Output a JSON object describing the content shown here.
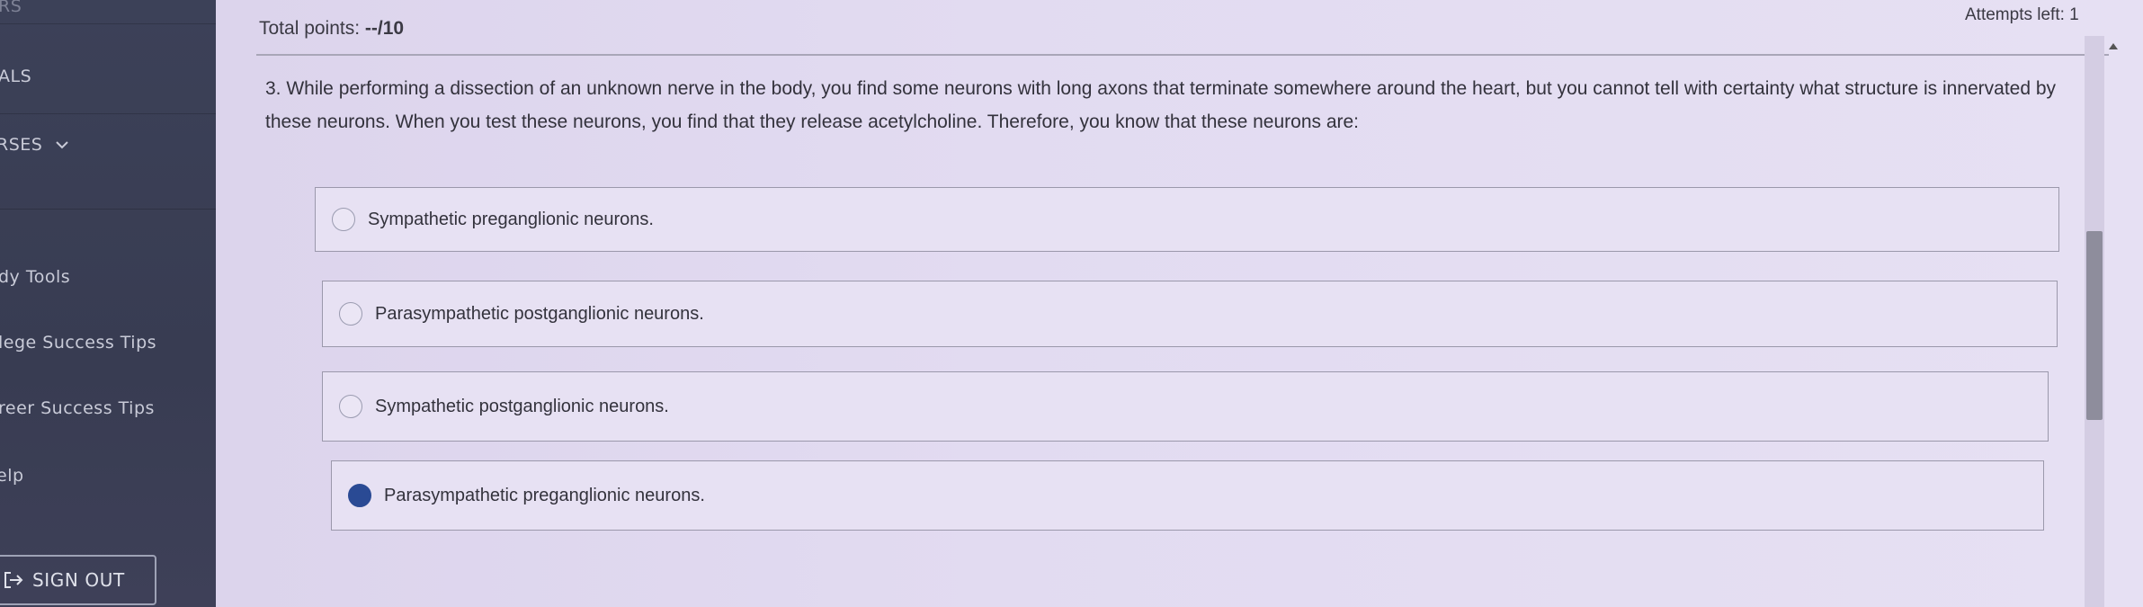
{
  "sidebar": {
    "items": [
      {
        "label": "RS"
      },
      {
        "label": "ALS"
      },
      {
        "label": "RSES"
      },
      {
        "label": "dy Tools"
      },
      {
        "label": "lege Success Tips"
      },
      {
        "label": "reer Success Tips"
      },
      {
        "label": "elp"
      }
    ],
    "sign_out_label": "SIGN OUT"
  },
  "header": {
    "total_points_label": "Total points: ",
    "total_points_value": "--/10",
    "attempts_left": "Attempts left: 1"
  },
  "question": {
    "text": "3. While performing a dissection of an unknown nerve in the body, you find some neurons with long axons that terminate somewhere around the heart, but you cannot tell with certainty what structure is innervated by these neurons. When you test these neurons, you find that they release acetylcholine. Therefore, you know that these neurons are:",
    "options": [
      {
        "label": "Sympathetic preganglionic neurons.",
        "selected": false
      },
      {
        "label": "Parasympathetic postganglionic neurons.",
        "selected": false
      },
      {
        "label": "Sympathetic postganglionic neurons.",
        "selected": false
      },
      {
        "label": "Parasympathetic preganglionic neurons.",
        "selected": true
      }
    ]
  },
  "colors": {
    "sidebar_bg": "#3c4158",
    "main_bg": "#e2dbf1",
    "selected_radio": "#2a4a94"
  }
}
